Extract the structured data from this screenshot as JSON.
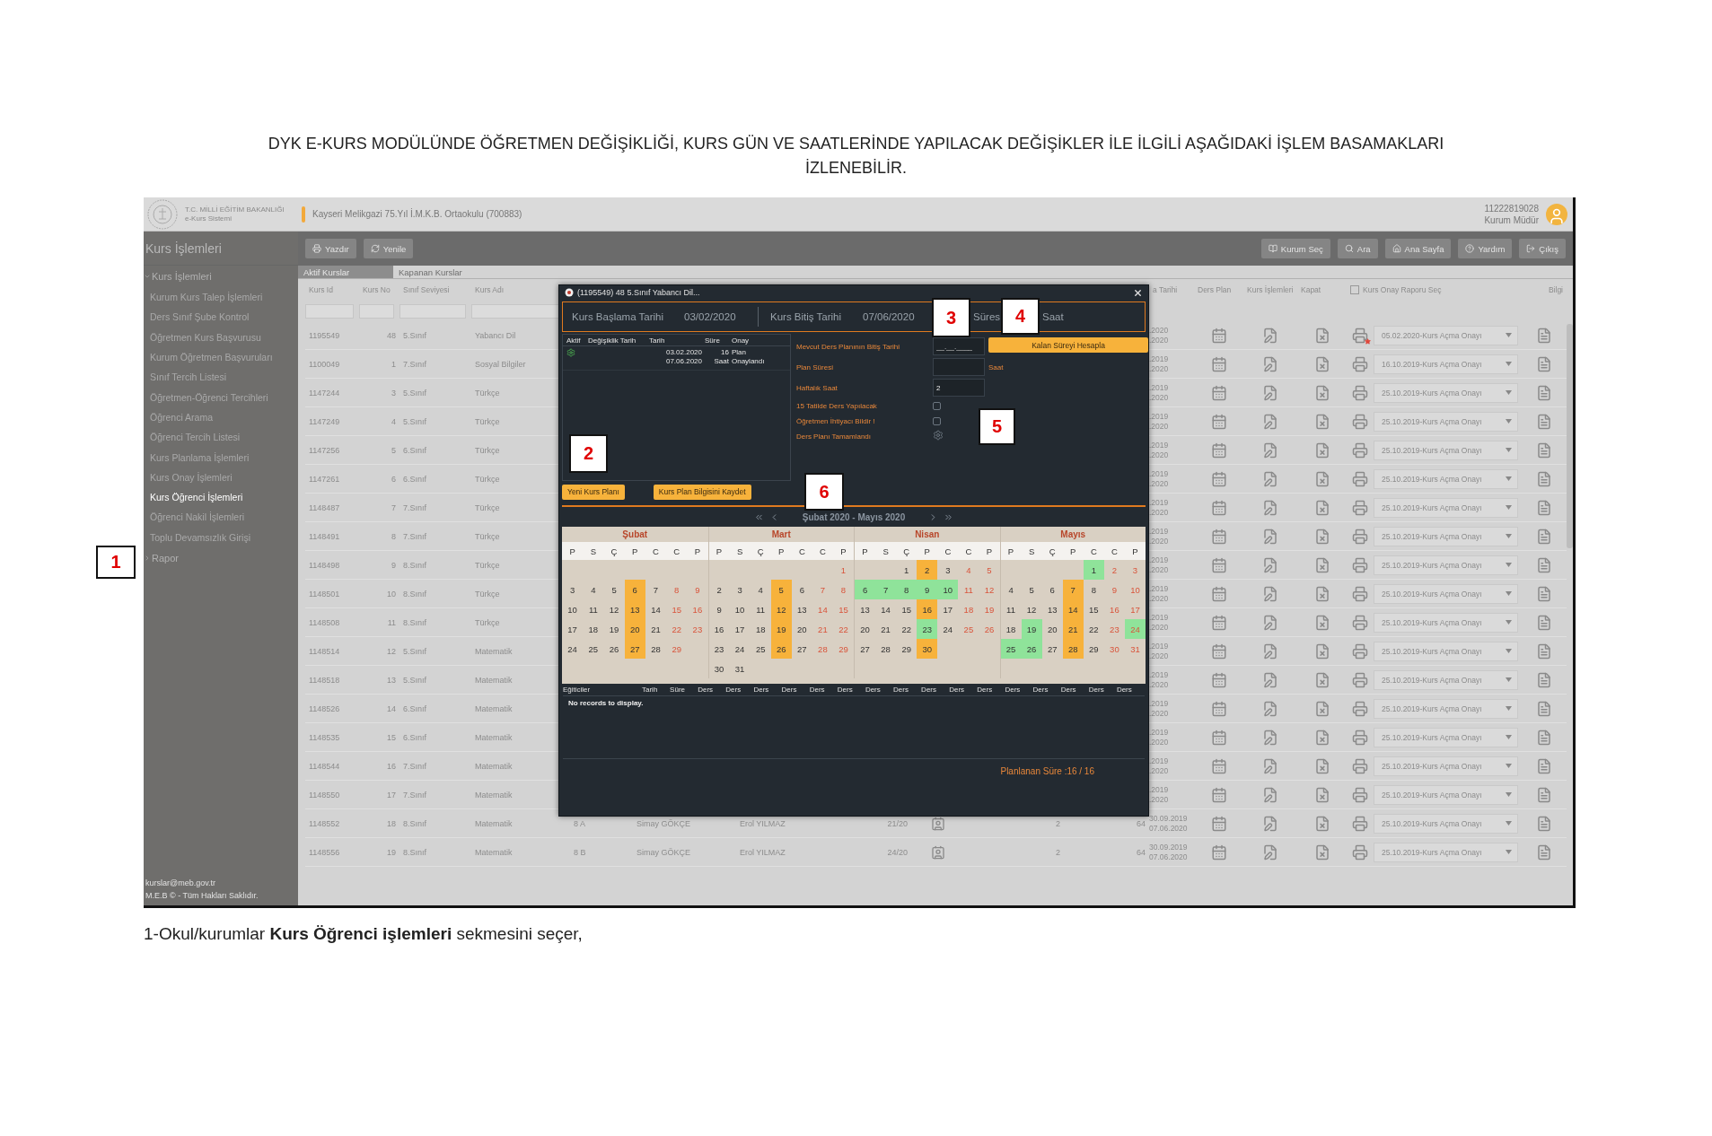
{
  "document": {
    "title_lines": [
      "DYK E-KURS MODÜLÜNDE ÖĞRETMEN DEĞİŞİKLİĞİ, KURS GÜN VE SAATLERİNDE YAPILACAK DEĞİŞİKLER İLE İLGİLİ AŞAĞIDAKİ İŞLEM BASAMAKLARI",
      "İZLENEBİLİR."
    ],
    "caption": "1-Okul/kurumlar **Kurs Öğrenci işlemleri** sekmesini seçer,"
  },
  "annotations": [
    {
      "label": "1"
    },
    {
      "label": "2"
    },
    {
      "label": "3"
    },
    {
      "label": "4"
    },
    {
      "label": "5"
    },
    {
      "label": "6"
    }
  ],
  "header": {
    "ministry": "T.C. MİLLİ EĞİTİM BAKANLIĞI",
    "system": "e-Kurs Sistemi",
    "school": "Kayseri Melikgazi 75.Yıl İ.M.K.B. Ortaokulu (700883)",
    "user_id": "11222819028",
    "user_role": "Kurum Müdür"
  },
  "sidebar": {
    "title": "Kurs İşlemleri",
    "groups": [
      {
        "label": "Kurs İşlemleri",
        "expanded": true,
        "children": [
          {
            "label": "Kurum Kurs Talep İşlemleri",
            "selected": false
          },
          {
            "label": "Ders Sınıf Şube Kontrol",
            "selected": false
          },
          {
            "label": "Öğretmen Kurs Başvurusu",
            "selected": false
          },
          {
            "label": "Kurum Öğretmen Başvuruları",
            "selected": false
          },
          {
            "label": "Sınıf Tercih Listesi",
            "selected": false
          },
          {
            "label": "Öğretmen-Öğrenci Tercihleri",
            "selected": false
          },
          {
            "label": "Öğrenci Arama",
            "selected": false
          },
          {
            "label": "Öğrenci Tercih Listesi",
            "selected": false
          },
          {
            "label": "Kurs Planlama İşlemleri",
            "selected": false
          },
          {
            "label": "Kurs Onay İşlemleri",
            "selected": false
          },
          {
            "label": "Kurs Öğrenci İşlemleri",
            "selected": true
          },
          {
            "label": "Öğrenci Nakil İşlemleri",
            "selected": false
          },
          {
            "label": "Toplu Devamsızlık Girişi",
            "selected": false
          }
        ]
      },
      {
        "label": "Rapor",
        "expanded": false
      }
    ],
    "footer": [
      "kurslar@meb.gov.tr",
      "M.E.B © - Tüm Hakları Saklıdır."
    ]
  },
  "toolbar": {
    "left": [
      {
        "label": "Yazdır",
        "kind": "print"
      },
      {
        "label": "Yenile",
        "kind": "refresh"
      }
    ],
    "right": [
      {
        "label": "Kurum Seç",
        "kind": "institution"
      },
      {
        "label": "Ara",
        "kind": "search"
      },
      {
        "label": "Ana Sayfa",
        "kind": "home"
      },
      {
        "label": "Yardım",
        "kind": "help"
      },
      {
        "label": "Çıkış",
        "kind": "exit"
      }
    ]
  },
  "tabs": [
    {
      "label": "Aktif Kurslar",
      "selected": true
    },
    {
      "label": "Kapanan Kurslar",
      "selected": false
    }
  ],
  "table": {
    "columns": {
      "kurs_id": "Kurs Id",
      "kurs_no": "Kurs No",
      "sinif": "Sınıf Seviyesi",
      "kurs_adi": "Kurs Adı",
      "dates": "a Tarihi",
      "ders_plan": "Ders Plan",
      "kurs_islemleri": "Kurs İşlemleri",
      "kapat": "Kapat",
      "bilgi": "Bilgi"
    },
    "report_select": {
      "label": "Kurs Onay Raporu Seç",
      "checked": false
    },
    "rows": [
      {
        "kurs_id": "1195549",
        "kurs_no": "48",
        "sinif": "5.Sınıf",
        "kurs_adi": "Yabancı Dil",
        "dates": [
          ".2020",
          ".2020"
        ],
        "report": "05.02.2020-Kurs Açma Onayı",
        "flagged": true
      },
      {
        "kurs_id": "1100049",
        "kurs_no": "1",
        "sinif": "7.Sınıf",
        "kurs_adi": "Sosyal Bilgiler",
        "dates": [
          ".2019",
          ".2020"
        ],
        "report": "16.10.2019-Kurs Açma Onayı",
        "flagged": false
      },
      {
        "kurs_id": "1147244",
        "kurs_no": "3",
        "sinif": "5.Sınıf",
        "kurs_adi": "Türkçe",
        "dates": [
          ".2019",
          ".2020"
        ],
        "report": "25.10.2019-Kurs Açma Onayı",
        "flagged": false
      },
      {
        "kurs_id": "1147249",
        "kurs_no": "4",
        "sinif": "5.Sınıf",
        "kurs_adi": "Türkçe",
        "dates": [
          ".2019",
          ".2020"
        ],
        "report": "25.10.2019-Kurs Açma Onayı",
        "flagged": false
      },
      {
        "kurs_id": "1147256",
        "kurs_no": "5",
        "sinif": "6.Sınıf",
        "kurs_adi": "Türkçe",
        "dates": [
          ".2019",
          ".2020"
        ],
        "report": "25.10.2019-Kurs Açma Onayı",
        "flagged": false
      },
      {
        "kurs_id": "1147261",
        "kurs_no": "6",
        "sinif": "6.Sınıf",
        "kurs_adi": "Türkçe",
        "dates": [
          ".2019",
          ".2020"
        ],
        "report": "25.10.2019-Kurs Açma Onayı",
        "flagged": false
      },
      {
        "kurs_id": "1148487",
        "kurs_no": "7",
        "sinif": "7.Sınıf",
        "kurs_adi": "Türkçe",
        "dates": [
          ".2019",
          ".2020"
        ],
        "report": "25.10.2019-Kurs Açma Onayı",
        "flagged": false
      },
      {
        "kurs_id": "1148491",
        "kurs_no": "8",
        "sinif": "7.Sınıf",
        "kurs_adi": "Türkçe",
        "dates": [
          ".2019",
          ".2020"
        ],
        "report": "25.10.2019-Kurs Açma Onayı",
        "flagged": false
      },
      {
        "kurs_id": "1148498",
        "kurs_no": "9",
        "sinif": "8.Sınıf",
        "kurs_adi": "Türkçe",
        "dates": [
          ".2019",
          ".2020"
        ],
        "report": "25.10.2019-Kurs Açma Onayı",
        "flagged": false
      },
      {
        "kurs_id": "1148501",
        "kurs_no": "10",
        "sinif": "8.Sınıf",
        "kurs_adi": "Türkçe",
        "dates": [
          ".2019",
          ".2020"
        ],
        "report": "25.10.2019-Kurs Açma Onayı",
        "flagged": false
      },
      {
        "kurs_id": "1148508",
        "kurs_no": "11",
        "sinif": "8.Sınıf",
        "kurs_adi": "Türkçe",
        "dates": [
          ".2019",
          ".2020"
        ],
        "report": "25.10.2019-Kurs Açma Onayı",
        "flagged": false
      },
      {
        "kurs_id": "1148514",
        "kurs_no": "12",
        "sinif": "5.Sınıf",
        "kurs_adi": "Matematik",
        "dates": [
          ".2019",
          ".2020"
        ],
        "report": "25.10.2019-Kurs Açma Onayı",
        "flagged": false
      },
      {
        "kurs_id": "1148518",
        "kurs_no": "13",
        "sinif": "5.Sınıf",
        "kurs_adi": "Matematik",
        "dates": [
          ".2019",
          ".2020"
        ],
        "report": "25.10.2019-Kurs Açma Onayı",
        "flagged": false
      },
      {
        "kurs_id": "1148526",
        "kurs_no": "14",
        "sinif": "6.Sınıf",
        "kurs_adi": "Matematik",
        "dates": [
          ".2019",
          ".2020"
        ],
        "report": "25.10.2019-Kurs Açma Onayı",
        "flagged": false
      },
      {
        "kurs_id": "1148535",
        "kurs_no": "15",
        "sinif": "6.Sınıf",
        "kurs_adi": "Matematik",
        "dates": [
          ".2019",
          ".2020"
        ],
        "report": "25.10.2019-Kurs Açma Onayı",
        "flagged": false
      },
      {
        "kurs_id": "1148544",
        "kurs_no": "16",
        "sinif": "7.Sınıf",
        "kurs_adi": "Matematik",
        "dates": [
          ".2019",
          ".2020"
        ],
        "report": "25.10.2019-Kurs Açma Onayı",
        "flagged": false
      },
      {
        "kurs_id": "1148550",
        "kurs_no": "17",
        "sinif": "7.Sınıf",
        "kurs_adi": "Matematik",
        "dates": [
          ".2019",
          ".2020"
        ],
        "report": "25.10.2019-Kurs Açma Onayı",
        "flagged": false
      },
      {
        "kurs_id": "1148552",
        "kurs_no": "18",
        "sinif": "8.Sınıf",
        "kurs_adi": "Matematik",
        "column_5": "8 A",
        "column_6": "Simay GÖKÇE",
        "column_7": "Erol YILMAZ",
        "column_8": "21/20",
        "column_10": "2",
        "column_11": "64",
        "dates": [
          "30.09.2019",
          "07.06.2020"
        ],
        "report": "25.10.2019-Kurs Açma Onayı",
        "flagged": false
      },
      {
        "kurs_id": "1148556",
        "kurs_no": "19",
        "sinif": "8.Sınıf",
        "kurs_adi": "Matematik",
        "column_5": "8 B",
        "column_6": "Simay GÖKÇE",
        "column_7": "Erol YILMAZ",
        "column_8": "24/20",
        "column_10": "2",
        "column_11": "64",
        "dates": [
          "30.09.2019",
          "07.06.2020"
        ],
        "report": "25.10.2019-Kurs Açma Onayı",
        "flagged": false
      }
    ]
  },
  "modal": {
    "title": "(1195549) 48 5.Sınıf Yabancı Dil...",
    "info": [
      {
        "label": "Kurs Başlama Tarihi",
        "value": "03/02/2020"
      },
      {
        "label": "Kurs Bitiş Tarihi",
        "value": "07/06/2020"
      }
    ],
    "info_tail": [
      "Süres",
      "Saat"
    ],
    "plan_columns": [
      "Aktif",
      "Değişiklik Tarih",
      "Tarih",
      "Süre",
      "Onay"
    ],
    "plans": [
      {
        "active": true,
        "dates": [
          "03.02.2020",
          "07.06.2020"
        ],
        "duration": [
          "16",
          "Saat"
        ],
        "status": [
          "Plan",
          "Onaylandı"
        ]
      }
    ],
    "left_buttons": [
      "Yeni Kurs Planı",
      "Kurs Plan Bilgisini Kaydet"
    ],
    "form": {
      "end_date": {
        "label": "Mevcut Ders Planının Bitiş Tarihi",
        "placeholder": "__.__.____"
      },
      "calc_button": "Kalan Süreyi Hesapla",
      "plan_duration": {
        "label": "Plan Süresi",
        "unit": "Saat"
      },
      "weekly": {
        "label": "Haftalık Saat",
        "value": "2"
      },
      "checks": [
        {
          "label": "15 Tatilde Ders Yapılacak",
          "checked": false
        },
        {
          "label": "Öğretmen İhtiyacı Bildir !",
          "checked": false
        }
      ],
      "completed": {
        "label": "Ders Planı Tamamlandı",
        "done": false
      }
    },
    "calendar": {
      "range": "Şubat 2020 - Mayıs 2020",
      "months": [
        {
          "name": "Şubat",
          "weekdays": [
            "P",
            "S",
            "Ç",
            "P",
            "C",
            "C",
            "P"
          ],
          "weeks": [
            [
              {
                "kind": "blank"
              },
              {
                "kind": "blank"
              },
              {
                "kind": "blank"
              },
              {
                "kind": "blank"
              },
              {
                "kind": "blank"
              },
              {
                "kind": "blank"
              },
              {
                "kind": "blank"
              }
            ],
            [
              {
                "kind": "day",
                "day": "3",
                "weekend": false,
                "planned": false,
                "holiday": false
              },
              {
                "kind": "day",
                "day": "4",
                "weekend": false,
                "planned": false,
                "holiday": false
              },
              {
                "kind": "day",
                "day": "5",
                "weekend": false,
                "planned": false,
                "holiday": false
              },
              {
                "kind": "day",
                "day": "6",
                "weekend": false,
                "planned": true,
                "holiday": false
              },
              {
                "kind": "day",
                "day": "7",
                "weekend": false,
                "planned": false,
                "holiday": false
              },
              {
                "kind": "day",
                "day": "8",
                "weekend": true,
                "planned": false,
                "holiday": false
              },
              {
                "kind": "day",
                "day": "9",
                "weekend": true,
                "planned": false,
                "holiday": false
              }
            ],
            [
              {
                "kind": "day",
                "day": "10",
                "weekend": false,
                "planned": false,
                "holiday": false
              },
              {
                "kind": "day",
                "day": "11",
                "weekend": false,
                "planned": false,
                "holiday": false
              },
              {
                "kind": "day",
                "day": "12",
                "weekend": false,
                "planned": false,
                "holiday": false
              },
              {
                "kind": "day",
                "day": "13",
                "weekend": false,
                "planned": true,
                "holiday": false
              },
              {
                "kind": "day",
                "day": "14",
                "weekend": false,
                "planned": false,
                "holiday": false
              },
              {
                "kind": "day",
                "day": "15",
                "weekend": true,
                "planned": false,
                "holiday": false
              },
              {
                "kind": "day",
                "day": "16",
                "weekend": true,
                "planned": false,
                "holiday": false
              }
            ],
            [
              {
                "kind": "day",
                "day": "17",
                "weekend": false,
                "planned": false,
                "holiday": false
              },
              {
                "kind": "day",
                "day": "18",
                "weekend": false,
                "planned": false,
                "holiday": false
              },
              {
                "kind": "day",
                "day": "19",
                "weekend": false,
                "planned": false,
                "holiday": false
              },
              {
                "kind": "day",
                "day": "20",
                "weekend": false,
                "planned": true,
                "holiday": false
              },
              {
                "kind": "day",
                "day": "21",
                "weekend": false,
                "planned": false,
                "holiday": false
              },
              {
                "kind": "day",
                "day": "22",
                "weekend": true,
                "planned": false,
                "holiday": false
              },
              {
                "kind": "day",
                "day": "23",
                "weekend": true,
                "planned": false,
                "holiday": false
              }
            ],
            [
              {
                "kind": "day",
                "day": "24",
                "weekend": false,
                "planned": false,
                "holiday": false
              },
              {
                "kind": "day",
                "day": "25",
                "weekend": false,
                "planned": false,
                "holiday": false
              },
              {
                "kind": "day",
                "day": "26",
                "weekend": false,
                "planned": false,
                "holiday": false
              },
              {
                "kind": "day",
                "day": "27",
                "weekend": false,
                "planned": true,
                "holiday": false
              },
              {
                "kind": "day",
                "day": "28",
                "weekend": false,
                "planned": false,
                "holiday": false
              },
              {
                "kind": "day",
                "day": "29",
                "weekend": true,
                "planned": false,
                "holiday": false
              },
              {
                "kind": "blank"
              }
            ],
            [
              {
                "kind": "blank"
              },
              {
                "kind": "blank"
              },
              {
                "kind": "blank"
              },
              {
                "kind": "blank"
              },
              {
                "kind": "blank"
              },
              {
                "kind": "blank"
              },
              {
                "kind": "blank"
              }
            ]
          ]
        },
        {
          "name": "Mart",
          "weekdays": [
            "P",
            "S",
            "Ç",
            "P",
            "C",
            "C",
            "P"
          ],
          "weeks": [
            [
              {
                "kind": "blank"
              },
              {
                "kind": "blank"
              },
              {
                "kind": "blank"
              },
              {
                "kind": "blank"
              },
              {
                "kind": "blank"
              },
              {
                "kind": "blank"
              },
              {
                "kind": "day",
                "day": "1",
                "weekend": true,
                "planned": false,
                "holiday": false
              }
            ],
            [
              {
                "kind": "day",
                "day": "2",
                "weekend": false,
                "planned": false,
                "holiday": false
              },
              {
                "kind": "day",
                "day": "3",
                "weekend": false,
                "planned": false,
                "holiday": false
              },
              {
                "kind": "day",
                "day": "4",
                "weekend": false,
                "planned": false,
                "holiday": false
              },
              {
                "kind": "day",
                "day": "5",
                "weekend": false,
                "planned": true,
                "holiday": false
              },
              {
                "kind": "day",
                "day": "6",
                "weekend": false,
                "planned": false,
                "holiday": false
              },
              {
                "kind": "day",
                "day": "7",
                "weekend": true,
                "planned": false,
                "holiday": false
              },
              {
                "kind": "day",
                "day": "8",
                "weekend": true,
                "planned": false,
                "holiday": false
              }
            ],
            [
              {
                "kind": "day",
                "day": "9",
                "weekend": false,
                "planned": false,
                "holiday": false
              },
              {
                "kind": "day",
                "day": "10",
                "weekend": false,
                "planned": false,
                "holiday": false
              },
              {
                "kind": "day",
                "day": "11",
                "weekend": false,
                "planned": false,
                "holiday": false
              },
              {
                "kind": "day",
                "day": "12",
                "weekend": false,
                "planned": true,
                "holiday": false
              },
              {
                "kind": "day",
                "day": "13",
                "weekend": false,
                "planned": false,
                "holiday": false
              },
              {
                "kind": "day",
                "day": "14",
                "weekend": true,
                "planned": false,
                "holiday": false
              },
              {
                "kind": "day",
                "day": "15",
                "weekend": true,
                "planned": false,
                "holiday": false
              }
            ],
            [
              {
                "kind": "day",
                "day": "16",
                "weekend": false,
                "planned": false,
                "holiday": false
              },
              {
                "kind": "day",
                "day": "17",
                "weekend": false,
                "planned": false,
                "holiday": false
              },
              {
                "kind": "day",
                "day": "18",
                "weekend": false,
                "planned": false,
                "holiday": false
              },
              {
                "kind": "day",
                "day": "19",
                "weekend": false,
                "planned": true,
                "holiday": false
              },
              {
                "kind": "day",
                "day": "20",
                "weekend": false,
                "planned": false,
                "holiday": false
              },
              {
                "kind": "day",
                "day": "21",
                "weekend": true,
                "planned": false,
                "holiday": false
              },
              {
                "kind": "day",
                "day": "22",
                "weekend": true,
                "planned": false,
                "holiday": false
              }
            ],
            [
              {
                "kind": "day",
                "day": "23",
                "weekend": false,
                "planned": false,
                "holiday": false
              },
              {
                "kind": "day",
                "day": "24",
                "weekend": false,
                "planned": false,
                "holiday": false
              },
              {
                "kind": "day",
                "day": "25",
                "weekend": false,
                "planned": false,
                "holiday": false
              },
              {
                "kind": "day",
                "day": "26",
                "weekend": false,
                "planned": true,
                "holiday": false
              },
              {
                "kind": "day",
                "day": "27",
                "weekend": false,
                "planned": false,
                "holiday": false
              },
              {
                "kind": "day",
                "day": "28",
                "weekend": true,
                "planned": false,
                "holiday": false
              },
              {
                "kind": "day",
                "day": "29",
                "weekend": true,
                "planned": false,
                "holiday": false
              }
            ],
            [
              {
                "kind": "day",
                "day": "30",
                "weekend": false,
                "planned": false,
                "holiday": false
              },
              {
                "kind": "day",
                "day": "31",
                "weekend": false,
                "planned": false,
                "holiday": false
              },
              {
                "kind": "blank"
              },
              {
                "kind": "blank"
              },
              {
                "kind": "blank"
              },
              {
                "kind": "blank"
              },
              {
                "kind": "blank"
              }
            ]
          ]
        },
        {
          "name": "Nisan",
          "weekdays": [
            "P",
            "S",
            "Ç",
            "P",
            "C",
            "C",
            "P"
          ],
          "weeks": [
            [
              {
                "kind": "blank"
              },
              {
                "kind": "blank"
              },
              {
                "kind": "day",
                "day": "1",
                "weekend": false,
                "planned": false,
                "holiday": false
              },
              {
                "kind": "day",
                "day": "2",
                "weekend": false,
                "planned": true,
                "holiday": false
              },
              {
                "kind": "day",
                "day": "3",
                "weekend": false,
                "planned": false,
                "holiday": false
              },
              {
                "kind": "day",
                "day": "4",
                "weekend": true,
                "planned": false,
                "holiday": false
              },
              {
                "kind": "day",
                "day": "5",
                "weekend": true,
                "planned": false,
                "holiday": false
              }
            ],
            [
              {
                "kind": "day",
                "day": "6",
                "weekend": false,
                "planned": false,
                "holiday": true
              },
              {
                "kind": "day",
                "day": "7",
                "weekend": false,
                "planned": false,
                "holiday": true
              },
              {
                "kind": "day",
                "day": "8",
                "weekend": false,
                "planned": false,
                "holiday": true
              },
              {
                "kind": "day",
                "day": "9",
                "weekend": false,
                "planned": false,
                "holiday": true
              },
              {
                "kind": "day",
                "day": "10",
                "weekend": false,
                "planned": false,
                "holiday": true
              },
              {
                "kind": "day",
                "day": "11",
                "weekend": true,
                "planned": false,
                "holiday": false
              },
              {
                "kind": "day",
                "day": "12",
                "weekend": true,
                "planned": false,
                "holiday": false
              }
            ],
            [
              {
                "kind": "day",
                "day": "13",
                "weekend": false,
                "planned": false,
                "holiday": false
              },
              {
                "kind": "day",
                "day": "14",
                "weekend": false,
                "planned": false,
                "holiday": false
              },
              {
                "kind": "day",
                "day": "15",
                "weekend": false,
                "planned": false,
                "holiday": false
              },
              {
                "kind": "day",
                "day": "16",
                "weekend": false,
                "planned": true,
                "holiday": false
              },
              {
                "kind": "day",
                "day": "17",
                "weekend": false,
                "planned": false,
                "holiday": false
              },
              {
                "kind": "day",
                "day": "18",
                "weekend": true,
                "planned": false,
                "holiday": false
              },
              {
                "kind": "day",
                "day": "19",
                "weekend": true,
                "planned": false,
                "holiday": false
              }
            ],
            [
              {
                "kind": "day",
                "day": "20",
                "weekend": false,
                "planned": false,
                "holiday": false
              },
              {
                "kind": "day",
                "day": "21",
                "weekend": false,
                "planned": false,
                "holiday": false
              },
              {
                "kind": "day",
                "day": "22",
                "weekend": false,
                "planned": false,
                "holiday": false
              },
              {
                "kind": "day",
                "day": "23",
                "weekend": false,
                "planned": false,
                "holiday": true
              },
              {
                "kind": "day",
                "day": "24",
                "weekend": false,
                "planned": false,
                "holiday": false
              },
              {
                "kind": "day",
                "day": "25",
                "weekend": true,
                "planned": false,
                "holiday": false
              },
              {
                "kind": "day",
                "day": "26",
                "weekend": true,
                "planned": false,
                "holiday": false
              }
            ],
            [
              {
                "kind": "day",
                "day": "27",
                "weekend": false,
                "planned": false,
                "holiday": false
              },
              {
                "kind": "day",
                "day": "28",
                "weekend": false,
                "planned": false,
                "holiday": false
              },
              {
                "kind": "day",
                "day": "29",
                "weekend": false,
                "planned": false,
                "holiday": false
              },
              {
                "kind": "day",
                "day": "30",
                "weekend": false,
                "planned": true,
                "holiday": false
              },
              {
                "kind": "blank"
              },
              {
                "kind": "blank"
              },
              {
                "kind": "blank"
              }
            ],
            [
              {
                "kind": "blank"
              },
              {
                "kind": "blank"
              },
              {
                "kind": "blank"
              },
              {
                "kind": "blank"
              },
              {
                "kind": "blank"
              },
              {
                "kind": "blank"
              },
              {
                "kind": "blank"
              }
            ]
          ]
        },
        {
          "name": "Mayıs",
          "weekdays": [
            "P",
            "S",
            "Ç",
            "P",
            "C",
            "C",
            "P"
          ],
          "weeks": [
            [
              {
                "kind": "blank"
              },
              {
                "kind": "blank"
              },
              {
                "kind": "blank"
              },
              {
                "kind": "blank"
              },
              {
                "kind": "day",
                "day": "1",
                "weekend": false,
                "planned": false,
                "holiday": true
              },
              {
                "kind": "day",
                "day": "2",
                "weekend": true,
                "planned": false,
                "holiday": false
              },
              {
                "kind": "day",
                "day": "3",
                "weekend": true,
                "planned": false,
                "holiday": false
              }
            ],
            [
              {
                "kind": "day",
                "day": "4",
                "weekend": false,
                "planned": false,
                "holiday": false
              },
              {
                "kind": "day",
                "day": "5",
                "weekend": false,
                "planned": false,
                "holiday": false
              },
              {
                "kind": "day",
                "day": "6",
                "weekend": false,
                "planned": false,
                "holiday": false
              },
              {
                "kind": "day",
                "day": "7",
                "weekend": false,
                "planned": true,
                "holiday": false
              },
              {
                "kind": "day",
                "day": "8",
                "weekend": false,
                "planned": false,
                "holiday": false
              },
              {
                "kind": "day",
                "day": "9",
                "weekend": true,
                "planned": false,
                "holiday": false
              },
              {
                "kind": "day",
                "day": "10",
                "weekend": true,
                "planned": false,
                "holiday": false
              }
            ],
            [
              {
                "kind": "day",
                "day": "11",
                "weekend": false,
                "planned": false,
                "holiday": false
              },
              {
                "kind": "day",
                "day": "12",
                "weekend": false,
                "planned": false,
                "holiday": false
              },
              {
                "kind": "day",
                "day": "13",
                "weekend": false,
                "planned": false,
                "holiday": false
              },
              {
                "kind": "day",
                "day": "14",
                "weekend": false,
                "planned": true,
                "holiday": false
              },
              {
                "kind": "day",
                "day": "15",
                "weekend": false,
                "planned": false,
                "holiday": false
              },
              {
                "kind": "day",
                "day": "16",
                "weekend": true,
                "planned": false,
                "holiday": false
              },
              {
                "kind": "day",
                "day": "17",
                "weekend": true,
                "planned": false,
                "holiday": false
              }
            ],
            [
              {
                "kind": "day",
                "day": "18",
                "weekend": false,
                "planned": false,
                "holiday": false
              },
              {
                "kind": "day",
                "day": "19",
                "weekend": false,
                "planned": false,
                "holiday": true
              },
              {
                "kind": "day",
                "day": "20",
                "weekend": false,
                "planned": false,
                "holiday": false
              },
              {
                "kind": "day",
                "day": "21",
                "weekend": false,
                "planned": true,
                "holiday": false
              },
              {
                "kind": "day",
                "day": "22",
                "weekend": false,
                "planned": false,
                "holiday": false
              },
              {
                "kind": "day",
                "day": "23",
                "weekend": true,
                "planned": false,
                "holiday": false
              },
              {
                "kind": "day",
                "day": "24",
                "weekend": true,
                "planned": false,
                "holiday": true
              }
            ],
            [
              {
                "kind": "day",
                "day": "25",
                "weekend": false,
                "planned": false,
                "holiday": true
              },
              {
                "kind": "day",
                "day": "26",
                "weekend": false,
                "planned": false,
                "holiday": true
              },
              {
                "kind": "day",
                "day": "27",
                "weekend": false,
                "planned": false,
                "holiday": false
              },
              {
                "kind": "day",
                "day": "28",
                "weekend": false,
                "planned": true,
                "holiday": false
              },
              {
                "kind": "day",
                "day": "29",
                "weekend": false,
                "planned": false,
                "holiday": false
              },
              {
                "kind": "day",
                "day": "30",
                "weekend": true,
                "planned": false,
                "holiday": false
              },
              {
                "kind": "day",
                "day": "31",
                "weekend": true,
                "planned": false,
                "holiday": false
              }
            ],
            [
              {
                "kind": "blank"
              },
              {
                "kind": "blank"
              },
              {
                "kind": "blank"
              },
              {
                "kind": "blank"
              },
              {
                "kind": "blank"
              },
              {
                "kind": "blank"
              },
              {
                "kind": "blank"
              }
            ]
          ]
        }
      ]
    },
    "trainers": {
      "columns": [
        "Eğiticiler",
        "Tarih",
        "Süre",
        "Ders",
        "Ders",
        "Ders",
        "Ders",
        "Ders",
        "Ders",
        "Ders",
        "Ders",
        "Ders",
        "Ders",
        "Ders",
        "Ders",
        "Ders",
        "Ders",
        "Ders",
        "Ders"
      ],
      "empty": "No records to display."
    },
    "planned": "Planlanan Süre :16 / 16"
  }
}
